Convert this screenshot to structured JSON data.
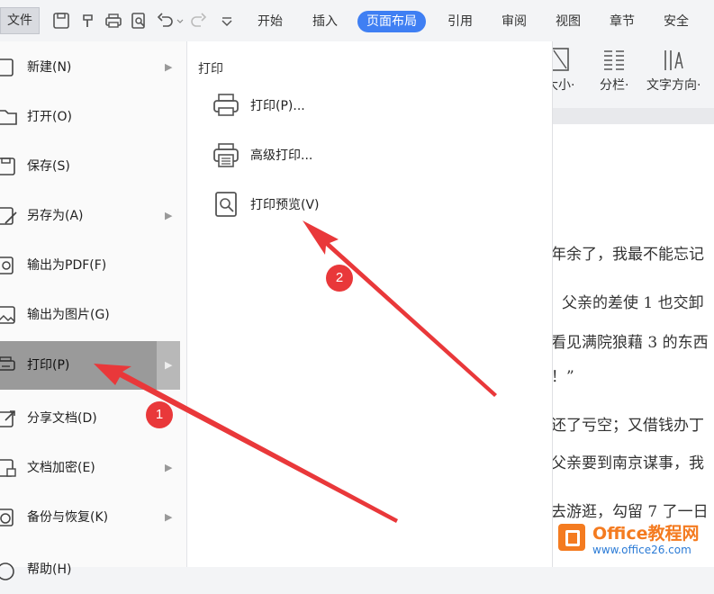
{
  "toolbar": {
    "file_label": "文件",
    "tabs": [
      "开始",
      "插入",
      "页面布局",
      "引用",
      "审阅",
      "视图",
      "章节",
      "安全"
    ],
    "active_tab": "页面布局",
    "accent_color": "#3f7ff3"
  },
  "ribbon": {
    "items": [
      {
        "label": "大小·",
        "icon": "page-size-icon"
      },
      {
        "label": "分栏·",
        "icon": "columns-icon"
      },
      {
        "label": "文字方向·",
        "icon": "text-direction-icon"
      }
    ]
  },
  "file_menu": {
    "items": [
      {
        "label": "新建(N)",
        "icon": "new-document-icon",
        "has_submenu": true
      },
      {
        "label": "打开(O)",
        "icon": "folder-open-icon",
        "has_submenu": false
      },
      {
        "label": "保存(S)",
        "icon": "save-icon",
        "has_submenu": false
      },
      {
        "label": "另存为(A)",
        "icon": "save-as-icon",
        "has_submenu": true
      },
      {
        "label": "输出为PDF(F)",
        "icon": "pdf-export-icon",
        "has_submenu": false
      },
      {
        "label": "输出为图片(G)",
        "icon": "image-export-icon",
        "has_submenu": false
      },
      {
        "label": "打印(P)",
        "icon": "printer-icon",
        "has_submenu": true,
        "selected": true
      },
      {
        "label": "分享文档(D)",
        "icon": "share-icon",
        "has_submenu": false
      },
      {
        "label": "文档加密(E)",
        "icon": "encrypt-icon",
        "has_submenu": true
      },
      {
        "label": "备份与恢复(K)",
        "icon": "backup-icon",
        "has_submenu": true
      },
      {
        "label": "帮助(H)",
        "icon": "help-icon",
        "has_submenu": false
      }
    ]
  },
  "submenu": {
    "title": "打印",
    "items": [
      {
        "label": "打印(P)...",
        "icon": "printer-icon"
      },
      {
        "label": "高级打印...",
        "icon": "advanced-print-icon"
      },
      {
        "label": "打印预览(V)",
        "icon": "print-preview-icon"
      }
    ]
  },
  "document": {
    "lines": [
      "年余了，我最不能忘记",
      "父亲的差使 1 也交卸",
      "看见满院狼藉 3 的东西",
      "！”",
      "还了亏空；又借钱办丁",
      "父亲要到南京谋事，我",
      "去游逛，勾留 7 了一日"
    ]
  },
  "annotations": {
    "badge_1": "1",
    "badge_2": "2",
    "arrow_color": "#e9383a"
  },
  "watermark": {
    "title": "Office教程网",
    "url": "www.office26.com"
  }
}
